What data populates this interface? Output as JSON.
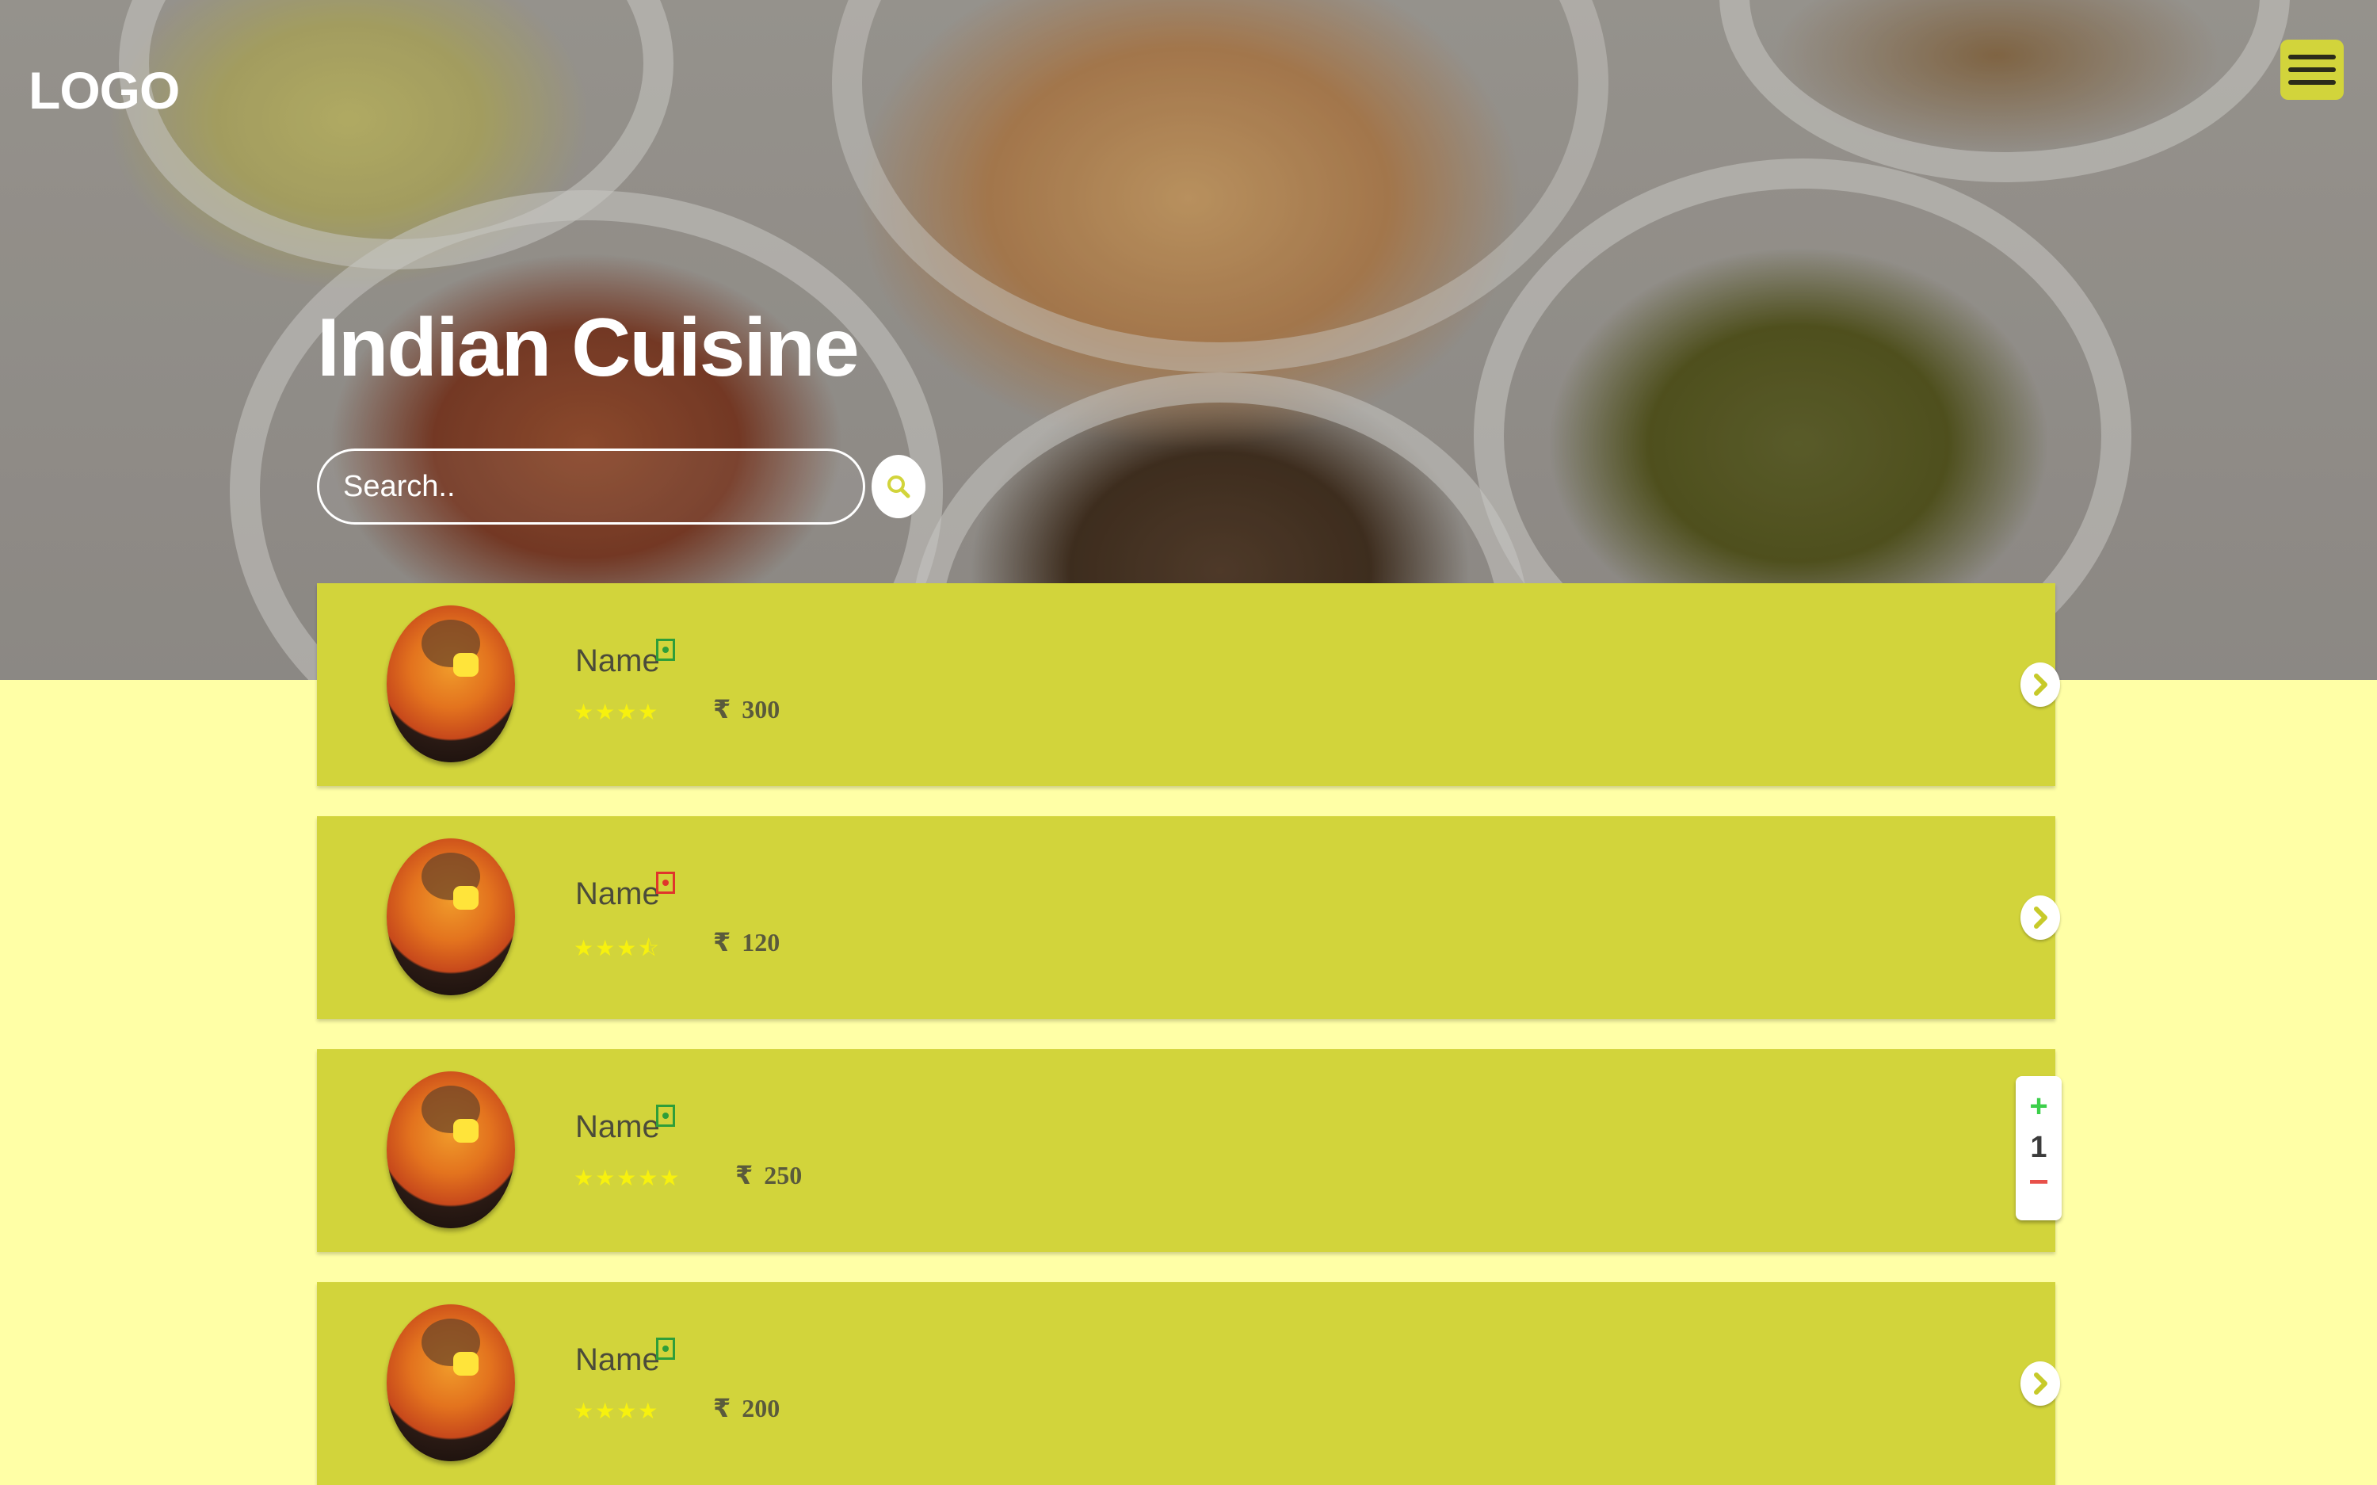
{
  "header": {
    "logo": "LOGO",
    "menu_icon": "hamburger-menu-icon"
  },
  "hero": {
    "title": "Indian Cuisine",
    "search_placeholder": "Search..",
    "search_icon": "search-icon"
  },
  "menu_items": [
    {
      "name": "Name",
      "diet": "veg",
      "rating": 4,
      "stars": "★★★★",
      "currency": "₹",
      "price": "300",
      "action": "chevron-right"
    },
    {
      "name": "Name",
      "diet": "non-veg",
      "rating": 3.5,
      "stars": "★★★⯪",
      "currency": "₹",
      "price": "120",
      "action": "chevron-right"
    },
    {
      "name": "Name",
      "diet": "veg",
      "rating": 5,
      "stars": "★★★★★",
      "currency": "₹",
      "price": "250",
      "action": "quantity-stepper",
      "quantity": "1",
      "plus": "+",
      "minus": "−"
    },
    {
      "name": "Name",
      "diet": "veg",
      "rating": 4,
      "stars": "★★★★",
      "currency": "₹",
      "price": "200",
      "action": "chevron-right"
    }
  ],
  "colors": {
    "page_bg": "#ffffa6",
    "card_bg": "#d2d43b",
    "star": "#f7f10e",
    "veg": "#2e9e39",
    "non_veg": "#e0352b",
    "stepper_plus": "#3ccf4a",
    "stepper_minus": "#e8504a"
  }
}
